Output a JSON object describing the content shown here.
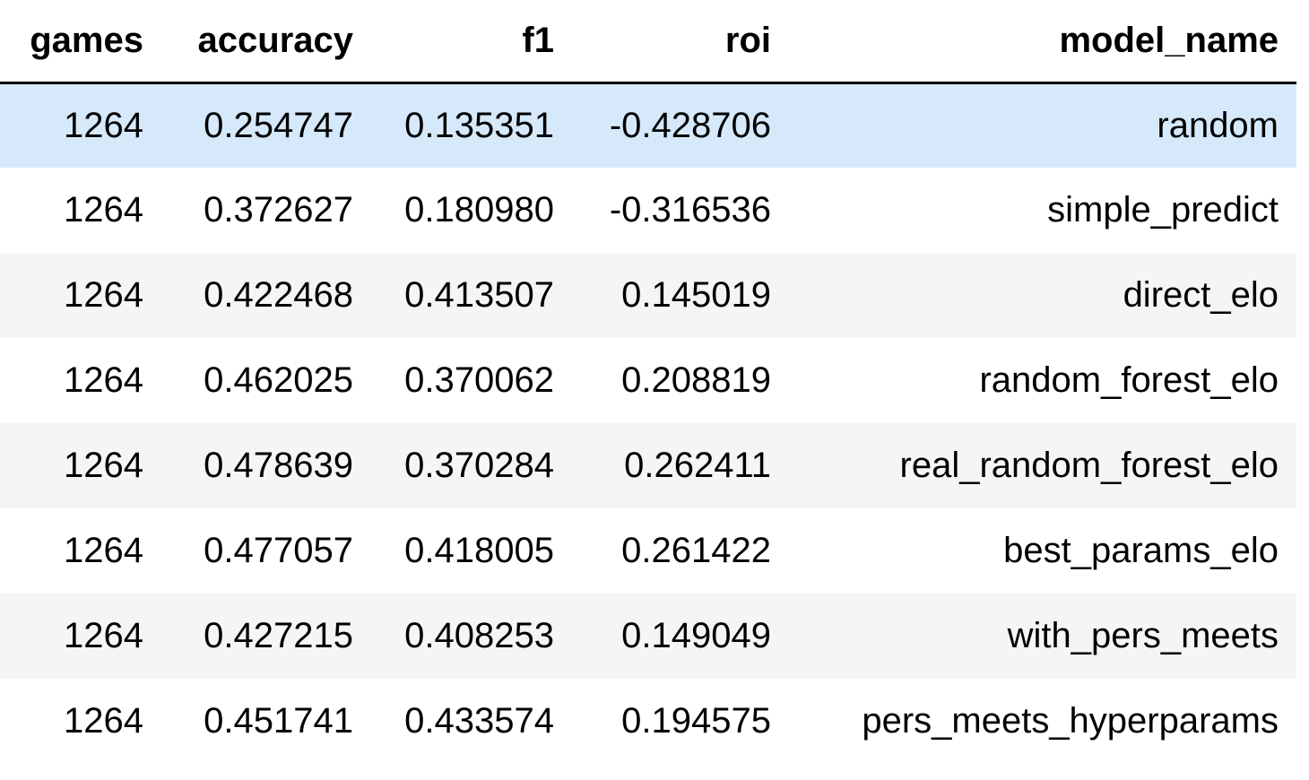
{
  "table": {
    "columns": [
      "games",
      "accuracy",
      "f1",
      "roi",
      "model_name"
    ],
    "rows": [
      [
        "1264",
        "0.254747",
        "0.135351",
        "-0.428706",
        "random"
      ],
      [
        "1264",
        "0.372627",
        "0.180980",
        "-0.316536",
        "simple_predict"
      ],
      [
        "1264",
        "0.422468",
        "0.413507",
        "0.145019",
        "direct_elo"
      ],
      [
        "1264",
        "0.462025",
        "0.370062",
        "0.208819",
        "random_forest_elo"
      ],
      [
        "1264",
        "0.478639",
        "0.370284",
        "0.262411",
        "real_random_forest_elo"
      ],
      [
        "1264",
        "0.477057",
        "0.418005",
        "0.261422",
        "best_params_elo"
      ],
      [
        "1264",
        "0.427215",
        "0.408253",
        "0.149049",
        "with_pers_meets"
      ],
      [
        "1264",
        "0.451741",
        "0.433574",
        "0.194575",
        "pers_meets_hyperparams"
      ]
    ],
    "highlight_color": "#d6e9fb",
    "stripe_color": "#f5f5f5"
  }
}
